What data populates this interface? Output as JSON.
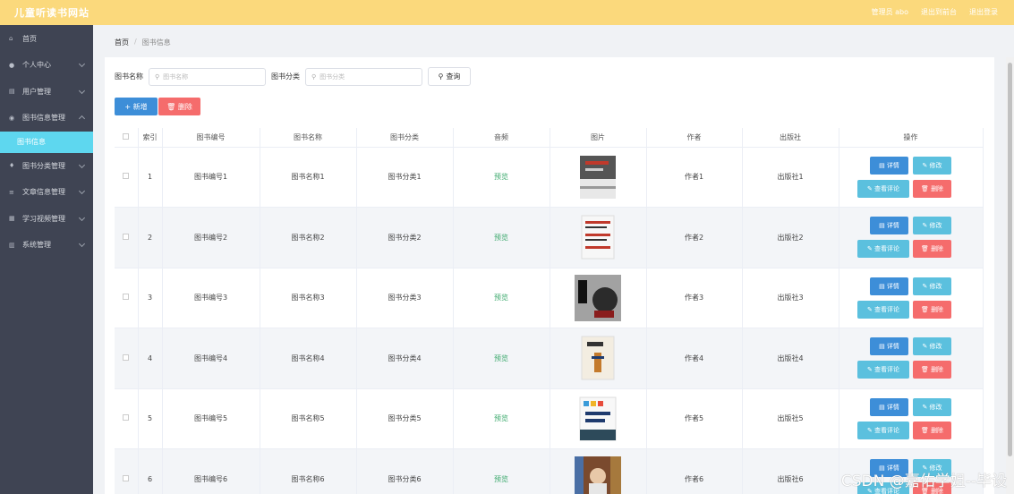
{
  "app": {
    "title": "儿童听读书网站",
    "top_links": [
      "管理员 abo",
      "退出到前台",
      "退出登录"
    ]
  },
  "sidebar": {
    "items": [
      {
        "label": "首页",
        "icon": "home-icon",
        "glyph": "⌂",
        "has_chevron": false
      },
      {
        "label": "个人中心",
        "icon": "user-icon",
        "glyph": "●",
        "has_chevron": true
      },
      {
        "label": "用户管理",
        "icon": "users-icon",
        "glyph": "▤",
        "has_chevron": true
      },
      {
        "label": "图书信息管理",
        "icon": "location-icon",
        "glyph": "◉",
        "has_chevron": true,
        "expanded": true
      }
    ],
    "sub_item": "图书信息",
    "items_after": [
      {
        "label": "图书分类管理",
        "icon": "mic-icon",
        "glyph": "♦",
        "has_chevron": true
      },
      {
        "label": "文章信息管理",
        "icon": "list-icon",
        "glyph": "≡",
        "has_chevron": true
      },
      {
        "label": "学习视频管理",
        "icon": "grid-icon",
        "glyph": "▦",
        "has_chevron": true
      },
      {
        "label": "系统管理",
        "icon": "stack-icon",
        "glyph": "▥",
        "has_chevron": true
      }
    ]
  },
  "breadcrumb": {
    "home": "首页",
    "separator": "/",
    "current": "图书信息"
  },
  "search": {
    "name_label": "图书名称",
    "name_placeholder": "图书名称",
    "category_label": "图书分类",
    "category_placeholder": "图书分类",
    "query_label": "查询"
  },
  "actions": {
    "add_label": "+ 新增",
    "delete_label": "🗑 删除"
  },
  "table": {
    "headers": [
      "",
      "索引",
      "图书编号",
      "图书名称",
      "图书分类",
      "音频",
      "图片",
      "作者",
      "出版社",
      "操作"
    ],
    "rows": [
      {
        "index": "1",
        "code": "图书编号1",
        "name": "图书名称1",
        "category": "图书分类1",
        "audio": "预览",
        "author": "作者1",
        "publisher": "出版社1"
      },
      {
        "index": "2",
        "code": "图书编号2",
        "name": "图书名称2",
        "category": "图书分类2",
        "audio": "预览",
        "author": "作者2",
        "publisher": "出版社2"
      },
      {
        "index": "3",
        "code": "图书编号3",
        "name": "图书名称3",
        "category": "图书分类3",
        "audio": "预览",
        "author": "作者3",
        "publisher": "出版社3"
      },
      {
        "index": "4",
        "code": "图书编号4",
        "name": "图书名称4",
        "category": "图书分类4",
        "audio": "预览",
        "author": "作者4",
        "publisher": "出版社4"
      },
      {
        "index": "5",
        "code": "图书编号5",
        "name": "图书名称5",
        "category": "图书分类5",
        "audio": "预览",
        "author": "作者5",
        "publisher": "出版社5"
      },
      {
        "index": "6",
        "code": "图书编号6",
        "name": "图书名称6",
        "category": "图书分类6",
        "audio": "预览",
        "author": "作者6",
        "publisher": "出版社6"
      }
    ],
    "ops": {
      "detail": "详情",
      "edit": "修改",
      "review": "查看评论",
      "delete": "删除"
    }
  },
  "watermark": "CSDN @嘉佑学姐--毕设",
  "colors": {
    "topbar": "#fbd97c",
    "sidebar": "#3f4453",
    "active": "#5ed7ef",
    "primary": "#3d8ed8",
    "info": "#5bc0de",
    "danger": "#f56c6c"
  }
}
